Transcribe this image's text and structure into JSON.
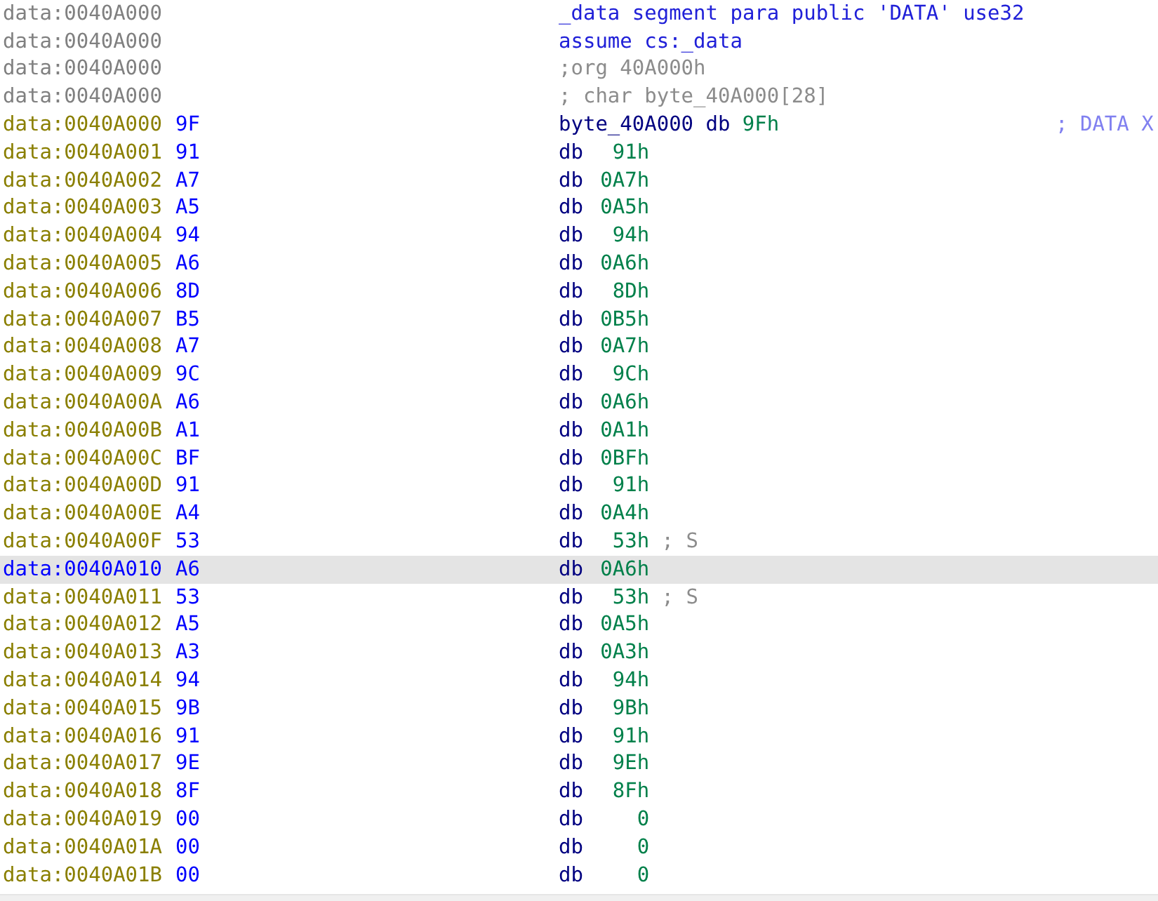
{
  "listing": [
    {
      "address": "data:0040A000",
      "kind": "directive",
      "text": "_data segment para public 'DATA' use32",
      "selected": false
    },
    {
      "address": "data:0040A000",
      "kind": "directive",
      "text": "assume cs:_data",
      "selected": false
    },
    {
      "address": "data:0040A000",
      "kind": "comment",
      "text": ";org 40A000h",
      "selected": false
    },
    {
      "address": "data:0040A000",
      "kind": "comment",
      "text": "; char byte_40A000[28]",
      "selected": false
    },
    {
      "address": "data:0040A000",
      "bytes": "9F",
      "kind": "labeled",
      "label": "byte_40A000",
      "mnemonic": "db",
      "operand": "9Fh",
      "xref": "; DATA X",
      "selected": false
    },
    {
      "address": "data:0040A001",
      "bytes": "91",
      "kind": "data",
      "mnemonic": "db",
      "operand": "91h",
      "selected": false
    },
    {
      "address": "data:0040A002",
      "bytes": "A7",
      "kind": "data",
      "mnemonic": "db",
      "operand": "0A7h",
      "selected": false
    },
    {
      "address": "data:0040A003",
      "bytes": "A5",
      "kind": "data",
      "mnemonic": "db",
      "operand": "0A5h",
      "selected": false
    },
    {
      "address": "data:0040A004",
      "bytes": "94",
      "kind": "data",
      "mnemonic": "db",
      "operand": "94h",
      "selected": false
    },
    {
      "address": "data:0040A005",
      "bytes": "A6",
      "kind": "data",
      "mnemonic": "db",
      "operand": "0A6h",
      "selected": false
    },
    {
      "address": "data:0040A006",
      "bytes": "8D",
      "kind": "data",
      "mnemonic": "db",
      "operand": "8Dh",
      "selected": false
    },
    {
      "address": "data:0040A007",
      "bytes": "B5",
      "kind": "data",
      "mnemonic": "db",
      "operand": "0B5h",
      "selected": false
    },
    {
      "address": "data:0040A008",
      "bytes": "A7",
      "kind": "data",
      "mnemonic": "db",
      "operand": "0A7h",
      "selected": false
    },
    {
      "address": "data:0040A009",
      "bytes": "9C",
      "kind": "data",
      "mnemonic": "db",
      "operand": "9Ch",
      "selected": false
    },
    {
      "address": "data:0040A00A",
      "bytes": "A6",
      "kind": "data",
      "mnemonic": "db",
      "operand": "0A6h",
      "selected": false
    },
    {
      "address": "data:0040A00B",
      "bytes": "A1",
      "kind": "data",
      "mnemonic": "db",
      "operand": "0A1h",
      "selected": false
    },
    {
      "address": "data:0040A00C",
      "bytes": "BF",
      "kind": "data",
      "mnemonic": "db",
      "operand": "0BFh",
      "selected": false
    },
    {
      "address": "data:0040A00D",
      "bytes": "91",
      "kind": "data",
      "mnemonic": "db",
      "operand": "91h",
      "selected": false
    },
    {
      "address": "data:0040A00E",
      "bytes": "A4",
      "kind": "data",
      "mnemonic": "db",
      "operand": "0A4h",
      "selected": false
    },
    {
      "address": "data:0040A00F",
      "bytes": "53",
      "kind": "data",
      "mnemonic": "db",
      "operand": "53h",
      "comment": "; S",
      "selected": false
    },
    {
      "address": "data:0040A010",
      "bytes": "A6",
      "kind": "data",
      "mnemonic": "db",
      "operand": "0A6h",
      "selected": true
    },
    {
      "address": "data:0040A011",
      "bytes": "53",
      "kind": "data",
      "mnemonic": "db",
      "operand": "53h",
      "comment": "; S",
      "selected": false
    },
    {
      "address": "data:0040A012",
      "bytes": "A5",
      "kind": "data",
      "mnemonic": "db",
      "operand": "0A5h",
      "selected": false
    },
    {
      "address": "data:0040A013",
      "bytes": "A3",
      "kind": "data",
      "mnemonic": "db",
      "operand": "0A3h",
      "selected": false
    },
    {
      "address": "data:0040A014",
      "bytes": "94",
      "kind": "data",
      "mnemonic": "db",
      "operand": "94h",
      "selected": false
    },
    {
      "address": "data:0040A015",
      "bytes": "9B",
      "kind": "data",
      "mnemonic": "db",
      "operand": "9Bh",
      "selected": false
    },
    {
      "address": "data:0040A016",
      "bytes": "91",
      "kind": "data",
      "mnemonic": "db",
      "operand": "91h",
      "selected": false
    },
    {
      "address": "data:0040A017",
      "bytes": "9E",
      "kind": "data",
      "mnemonic": "db",
      "operand": "9Eh",
      "selected": false
    },
    {
      "address": "data:0040A018",
      "bytes": "8F",
      "kind": "data",
      "mnemonic": "db",
      "operand": "8Fh",
      "selected": false
    },
    {
      "address": "data:0040A019",
      "bytes": "00",
      "kind": "data",
      "mnemonic": "db",
      "operand": "0",
      "selected": false
    },
    {
      "address": "data:0040A01A",
      "bytes": "00",
      "kind": "data",
      "mnemonic": "db",
      "operand": "0",
      "selected": false
    },
    {
      "address": "data:0040A01B",
      "bytes": "00",
      "kind": "data",
      "mnemonic": "db",
      "operand": "0",
      "selected": false
    }
  ]
}
